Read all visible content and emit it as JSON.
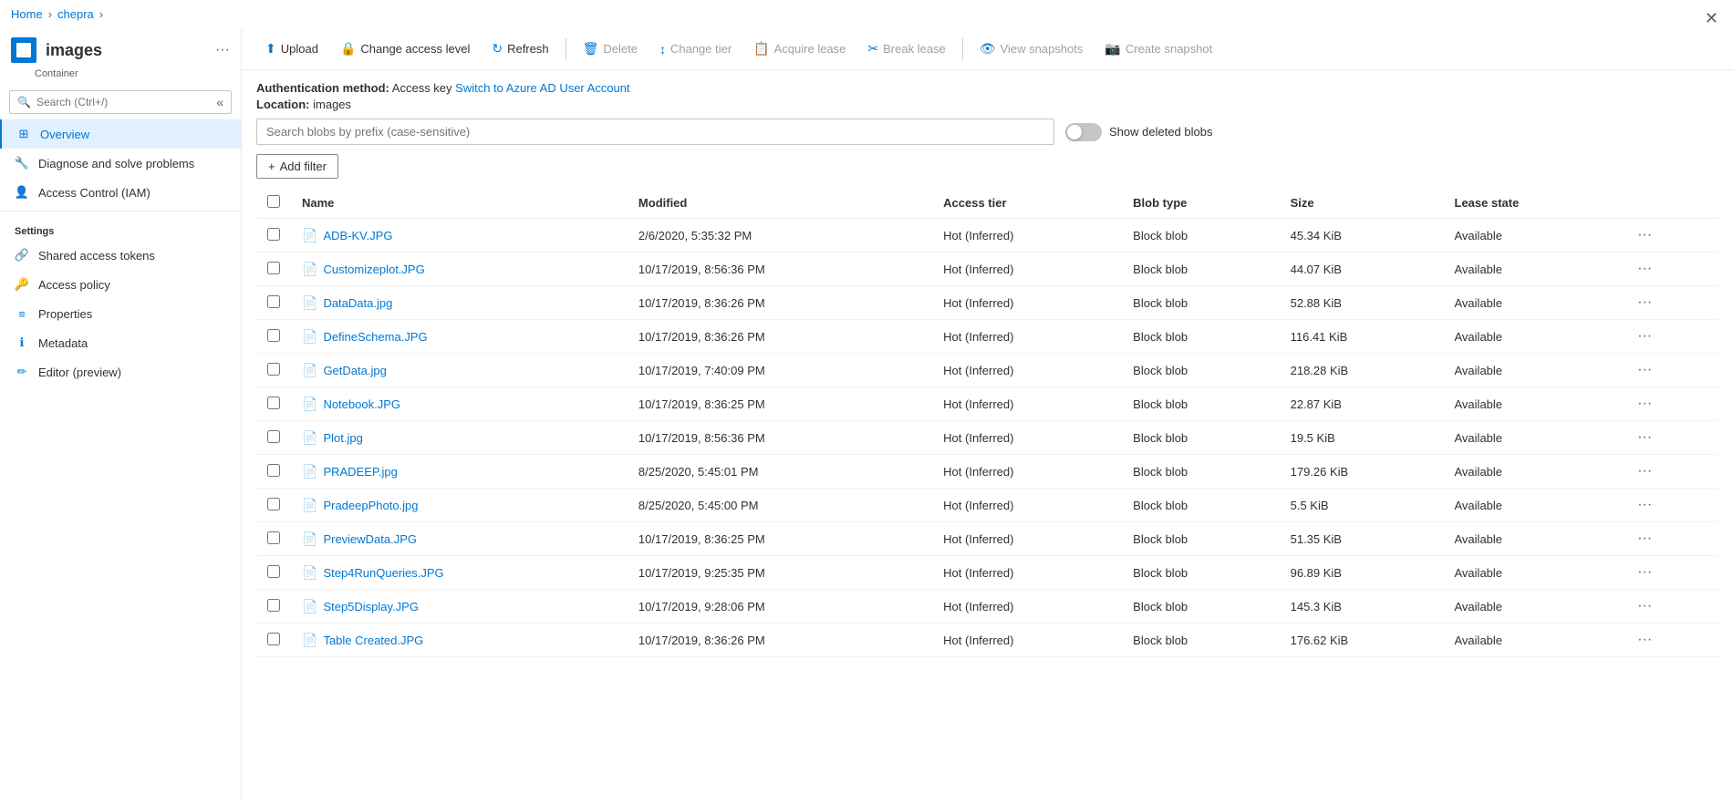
{
  "breadcrumb": {
    "home": "Home",
    "parent": "chepra",
    "separator": "›"
  },
  "container": {
    "title": "images",
    "subtitle": "Container",
    "more_label": "···"
  },
  "search": {
    "placeholder": "Search (Ctrl+/)"
  },
  "nav": {
    "items": [
      {
        "id": "overview",
        "label": "Overview",
        "active": true,
        "icon": "grid"
      },
      {
        "id": "diagnose",
        "label": "Diagnose and solve problems",
        "active": false,
        "icon": "wrench"
      },
      {
        "id": "iam",
        "label": "Access Control (IAM)",
        "active": false,
        "icon": "person"
      }
    ],
    "settings_label": "Settings",
    "settings_items": [
      {
        "id": "shared-access-tokens",
        "label": "Shared access tokens",
        "icon": "link"
      },
      {
        "id": "access-policy",
        "label": "Access policy",
        "icon": "key"
      },
      {
        "id": "properties",
        "label": "Properties",
        "icon": "bars"
      },
      {
        "id": "metadata",
        "label": "Metadata",
        "icon": "info"
      },
      {
        "id": "editor",
        "label": "Editor (preview)",
        "icon": "pencil"
      }
    ]
  },
  "toolbar": {
    "upload_label": "Upload",
    "change_access_label": "Change access level",
    "refresh_label": "Refresh",
    "delete_label": "Delete",
    "change_tier_label": "Change tier",
    "acquire_lease_label": "Acquire lease",
    "break_lease_label": "Break lease",
    "view_snapshots_label": "View snapshots",
    "create_snapshot_label": "Create snapshot"
  },
  "auth": {
    "method_label": "Authentication method:",
    "method_value": "Access key",
    "switch_label": "Switch to Azure AD User Account",
    "location_label": "Location:",
    "location_value": "images"
  },
  "blob_search": {
    "placeholder": "Search blobs by prefix (case-sensitive)"
  },
  "show_deleted": {
    "label": "Show deleted blobs"
  },
  "add_filter": {
    "label": "Add filter"
  },
  "table": {
    "columns": [
      "Name",
      "Modified",
      "Access tier",
      "Blob type",
      "Size",
      "Lease state"
    ],
    "rows": [
      {
        "name": "ADB-KV.JPG",
        "modified": "2/6/2020, 5:35:32 PM",
        "access_tier": "Hot (Inferred)",
        "blob_type": "Block blob",
        "size": "45.34 KiB",
        "lease_state": "Available"
      },
      {
        "name": "Customizeplot.JPG",
        "modified": "10/17/2019, 8:56:36 PM",
        "access_tier": "Hot (Inferred)",
        "blob_type": "Block blob",
        "size": "44.07 KiB",
        "lease_state": "Available"
      },
      {
        "name": "DataData.jpg",
        "modified": "10/17/2019, 8:36:26 PM",
        "access_tier": "Hot (Inferred)",
        "blob_type": "Block blob",
        "size": "52.88 KiB",
        "lease_state": "Available"
      },
      {
        "name": "DefineSchema.JPG",
        "modified": "10/17/2019, 8:36:26 PM",
        "access_tier": "Hot (Inferred)",
        "blob_type": "Block blob",
        "size": "116.41 KiB",
        "lease_state": "Available"
      },
      {
        "name": "GetData.jpg",
        "modified": "10/17/2019, 7:40:09 PM",
        "access_tier": "Hot (Inferred)",
        "blob_type": "Block blob",
        "size": "218.28 KiB",
        "lease_state": "Available"
      },
      {
        "name": "Notebook.JPG",
        "modified": "10/17/2019, 8:36:25 PM",
        "access_tier": "Hot (Inferred)",
        "blob_type": "Block blob",
        "size": "22.87 KiB",
        "lease_state": "Available"
      },
      {
        "name": "Plot.jpg",
        "modified": "10/17/2019, 8:56:36 PM",
        "access_tier": "Hot (Inferred)",
        "blob_type": "Block blob",
        "size": "19.5 KiB",
        "lease_state": "Available"
      },
      {
        "name": "PRADEEP.jpg",
        "modified": "8/25/2020, 5:45:01 PM",
        "access_tier": "Hot (Inferred)",
        "blob_type": "Block blob",
        "size": "179.26 KiB",
        "lease_state": "Available"
      },
      {
        "name": "PradeepPhoto.jpg",
        "modified": "8/25/2020, 5:45:00 PM",
        "access_tier": "Hot (Inferred)",
        "blob_type": "Block blob",
        "size": "5.5 KiB",
        "lease_state": "Available"
      },
      {
        "name": "PreviewData.JPG",
        "modified": "10/17/2019, 8:36:25 PM",
        "access_tier": "Hot (Inferred)",
        "blob_type": "Block blob",
        "size": "51.35 KiB",
        "lease_state": "Available"
      },
      {
        "name": "Step4RunQueries.JPG",
        "modified": "10/17/2019, 9:25:35 PM",
        "access_tier": "Hot (Inferred)",
        "blob_type": "Block blob",
        "size": "96.89 KiB",
        "lease_state": "Available"
      },
      {
        "name": "Step5Display.JPG",
        "modified": "10/17/2019, 9:28:06 PM",
        "access_tier": "Hot (Inferred)",
        "blob_type": "Block blob",
        "size": "145.3 KiB",
        "lease_state": "Available"
      },
      {
        "name": "Table Created.JPG",
        "modified": "10/17/2019, 8:36:26 PM",
        "access_tier": "Hot (Inferred)",
        "blob_type": "Block blob",
        "size": "176.62 KiB",
        "lease_state": "Available"
      }
    ]
  },
  "icons": {
    "search": "🔍",
    "upload": "⬆",
    "lock": "🔒",
    "refresh": "↻",
    "delete": "🗑",
    "tier": "↕",
    "lease": "📋",
    "break": "✂",
    "snapshot": "📷",
    "view": "👁",
    "grid": "⊞",
    "wrench": "🔧",
    "person": "👤",
    "link": "🔗",
    "key": "🔑",
    "bars": "≡",
    "info": "ℹ",
    "pencil": "✏",
    "file": "📄",
    "plus": "+",
    "more": "···",
    "close": "✕",
    "chevron": "›",
    "collapse": "«"
  }
}
